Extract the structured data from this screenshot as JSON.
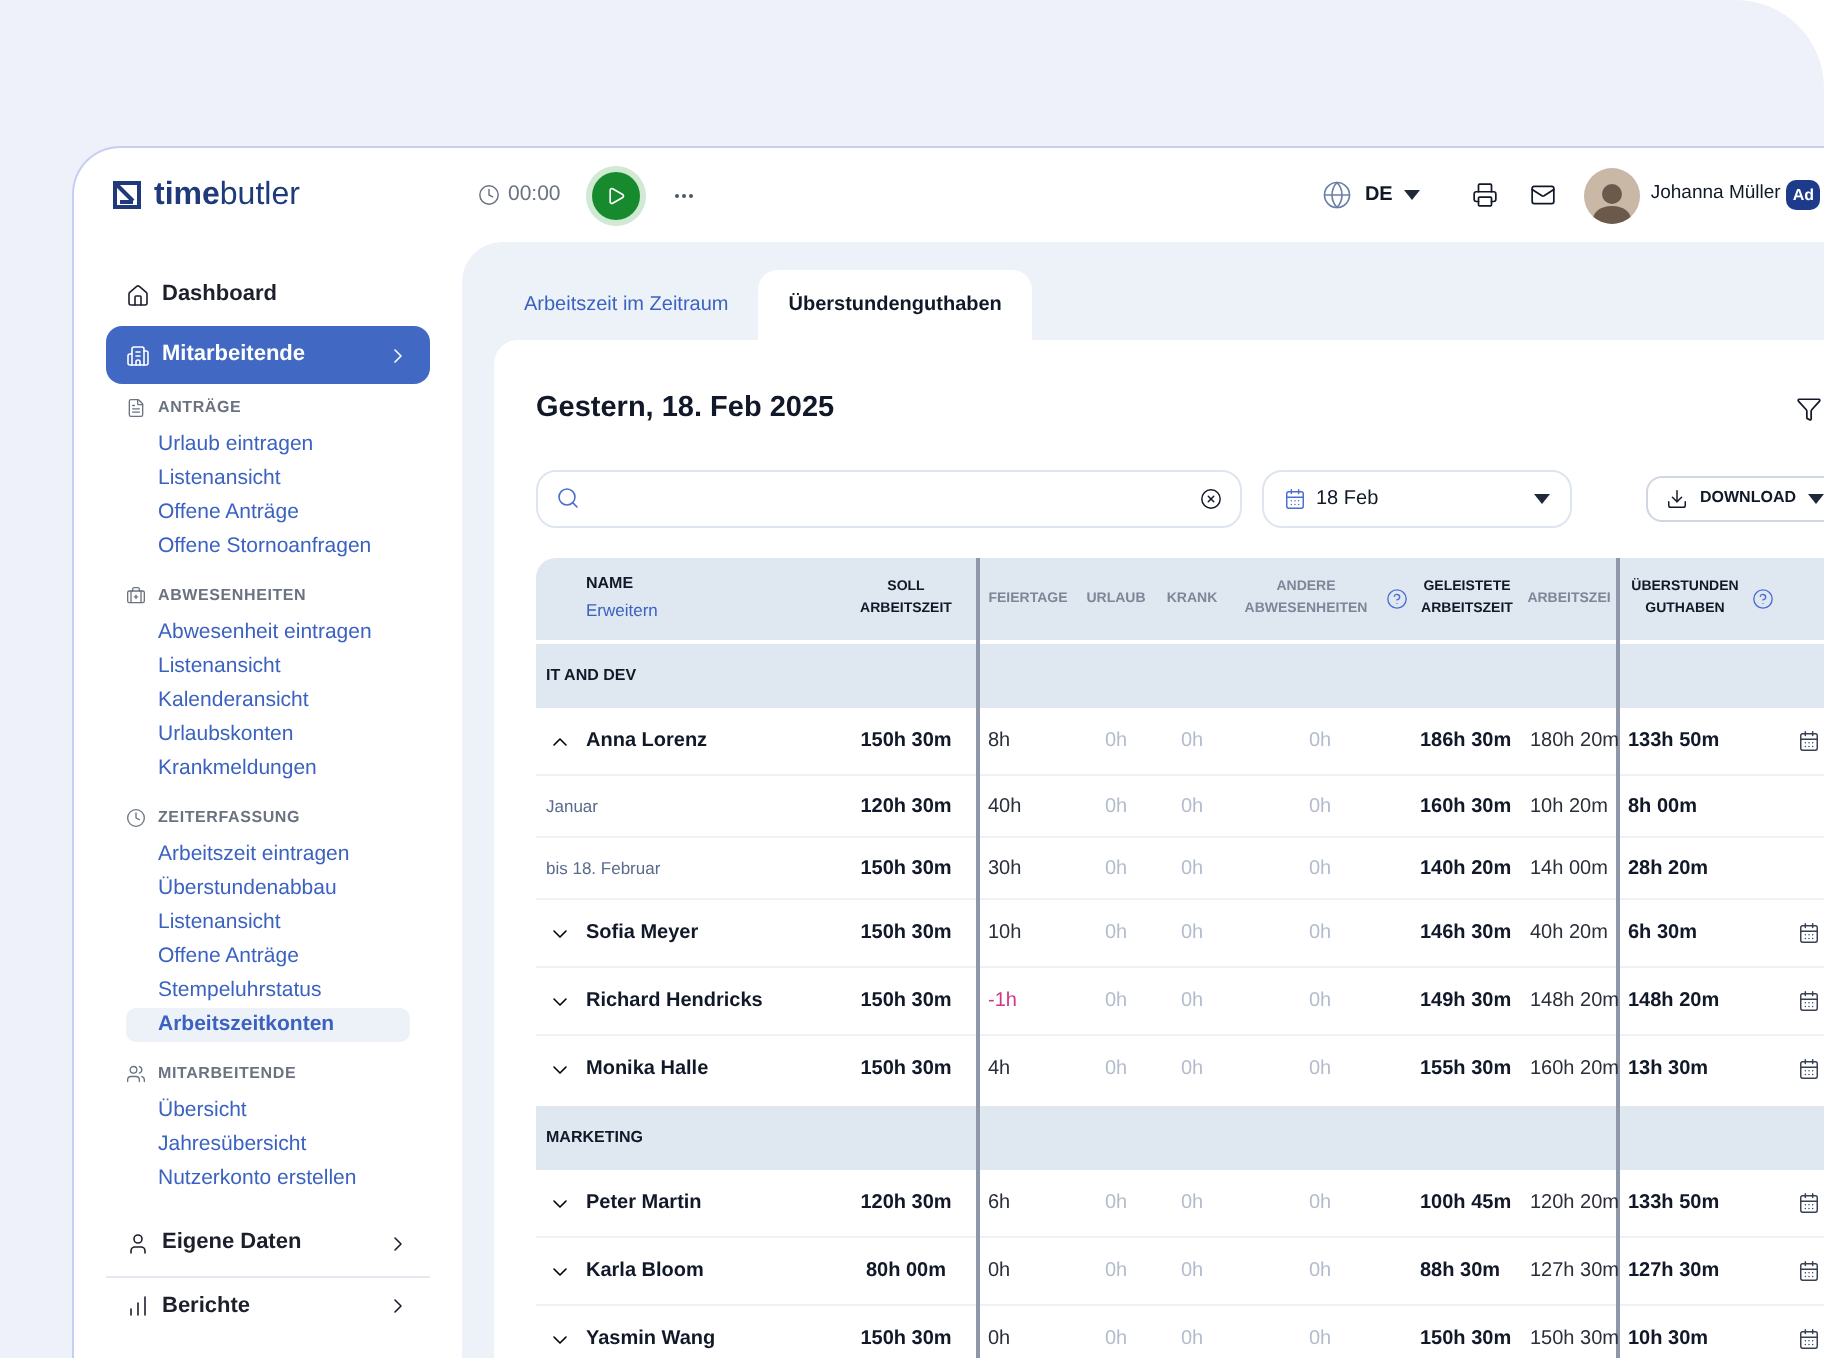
{
  "brand": {
    "name": "**time**butler"
  },
  "timer": {
    "time": "00:00"
  },
  "language": {
    "code": "DE"
  },
  "user": {
    "name": "Johanna Müller",
    "badge": "Ad"
  },
  "sidebar": {
    "items": [
      {
        "kind": "link",
        "label": "Dashboard",
        "selected": false
      },
      {
        "kind": "menu",
        "label": "Mitarbeitende",
        "selected": true
      },
      {
        "kind": "section",
        "label": "ANTRÄGE",
        "children": [
          {
            "label": "Urlaub eintragen",
            "selected": false
          },
          {
            "label": "Listenansicht",
            "selected": false
          },
          {
            "label": "Offene Anträge",
            "selected": false
          },
          {
            "label": "Offene Stornoanfragen",
            "selected": false
          }
        ]
      },
      {
        "kind": "section",
        "label": "ABWESENHEITEN",
        "children": [
          {
            "label": "Abwesenheit eintragen",
            "selected": false
          },
          {
            "label": "Listenansicht",
            "selected": false
          },
          {
            "label": "Kalenderansicht",
            "selected": false
          },
          {
            "label": "Urlaubskonten",
            "selected": false
          },
          {
            "label": "Krankmeldungen",
            "selected": false
          }
        ]
      },
      {
        "kind": "section",
        "label": "ZEITERFASSUNG",
        "children": [
          {
            "label": "Arbeitszeit eintragen",
            "selected": false
          },
          {
            "label": "Überstundenabbau",
            "selected": false
          },
          {
            "label": "Listenansicht",
            "selected": false
          },
          {
            "label": "Offene Anträge",
            "selected": false
          },
          {
            "label": "Stempeluhrstatus",
            "selected": false
          },
          {
            "label": "Arbeitszeitkonten",
            "selected": true
          }
        ]
      },
      {
        "kind": "section",
        "label": "MITARBEITENDE",
        "children": [
          {
            "label": "Übersicht",
            "selected": false
          },
          {
            "label": "Jahresübersicht",
            "selected": false
          },
          {
            "label": "Nutzerkonto erstellen",
            "selected": false
          }
        ]
      },
      {
        "kind": "menu",
        "label": "Eigene Daten",
        "selected": false
      },
      {
        "kind": "menu",
        "label": "Berichte",
        "selected": false
      }
    ]
  },
  "tabs": [
    {
      "label": "Arbeitszeit im Zeitraum",
      "selected": false
    },
    {
      "label": "Überstundenguthaben",
      "selected": true
    }
  ],
  "title": "Gestern, 18. Feb 2025",
  "date_picker": {
    "value": "18 Feb"
  },
  "download": {
    "label": "DOWNLOAD"
  },
  "table": {
    "name_column": {
      "label": "NAME",
      "link": "Erweitern"
    },
    "columns": [
      {
        "label": "SOLL ARBEITSZEIT",
        "bold": true,
        "help": false,
        "values_muted": false
      },
      {
        "label": "FEIERTAGE",
        "bold": false,
        "help": false,
        "values_muted": false
      },
      {
        "label": "URLAUB",
        "bold": false,
        "help": false,
        "values_muted": true
      },
      {
        "label": "KRANK",
        "bold": false,
        "help": false,
        "values_muted": true
      },
      {
        "label": "ANDERE ABWESENHEITEN",
        "bold": false,
        "help": true,
        "values_muted": true
      },
      {
        "label": "GELEISTETE ARBEITSZEIT",
        "bold": true,
        "help": false,
        "values_muted": false
      },
      {
        "label": "ARBEITSZEI",
        "bold": false,
        "help": false,
        "values_muted": false
      },
      {
        "label": "ÜBERSTUNDEN GUTHABEN",
        "bold": true,
        "help": true,
        "values_muted": false
      }
    ],
    "rows": [
      {
        "kind": "group",
        "label": "IT AND DEV"
      },
      {
        "kind": "employee",
        "label": "Anna Lorenz",
        "expanded": true,
        "holiday_negative": false,
        "values": [
          "150h 30m",
          "8h",
          "0h",
          "0h",
          "0h",
          "186h 30m",
          "180h 20m",
          "133h 50m"
        ]
      },
      {
        "kind": "period",
        "label": "Januar",
        "holiday_negative": false,
        "values": [
          "120h 30m",
          "40h",
          "0h",
          "0h",
          "0h",
          "160h 30m",
          "10h 20m",
          "8h 00m"
        ]
      },
      {
        "kind": "period",
        "label": "bis 18. Februar",
        "holiday_negative": false,
        "values": [
          "150h 30m",
          "30h",
          "0h",
          "0h",
          "0h",
          "140h 20m",
          "14h 00m",
          "28h 20m"
        ]
      },
      {
        "kind": "employee",
        "label": "Sofia Meyer",
        "expanded": false,
        "holiday_negative": false,
        "values": [
          "150h 30m",
          "10h",
          "0h",
          "0h",
          "0h",
          "146h 30m",
          "40h 20m",
          "6h 30m"
        ]
      },
      {
        "kind": "employee",
        "label": "Richard Hendricks",
        "expanded": false,
        "holiday_negative": true,
        "values": [
          "150h 30m",
          "-1h",
          "0h",
          "0h",
          "0h",
          "149h 30m",
          "148h 20m",
          "148h 20m"
        ]
      },
      {
        "kind": "employee",
        "label": "Monika Halle",
        "expanded": false,
        "holiday_negative": false,
        "values": [
          "150h 30m",
          "4h",
          "0h",
          "0h",
          "0h",
          "155h 30m",
          "160h 20m",
          "13h 30m"
        ]
      },
      {
        "kind": "group",
        "label": "MARKETING"
      },
      {
        "kind": "employee",
        "label": "Peter Martin",
        "expanded": false,
        "holiday_negative": false,
        "values": [
          "120h 30m",
          "6h",
          "0h",
          "0h",
          "0h",
          "100h 45m",
          "120h 20m",
          "133h 50m"
        ]
      },
      {
        "kind": "employee",
        "label": "Karla Bloom",
        "expanded": false,
        "holiday_negative": false,
        "values": [
          "80h 00m",
          "0h",
          "0h",
          "0h",
          "0h",
          "88h 30m",
          "127h 30m",
          "127h 30m"
        ]
      },
      {
        "kind": "employee",
        "label": "Yasmin Wang",
        "expanded": false,
        "holiday_negative": false,
        "values": [
          "150h 30m",
          "0h",
          "0h",
          "0h",
          "0h",
          "150h 30m",
          "150h 30m",
          "10h 30m"
        ]
      }
    ]
  }
}
